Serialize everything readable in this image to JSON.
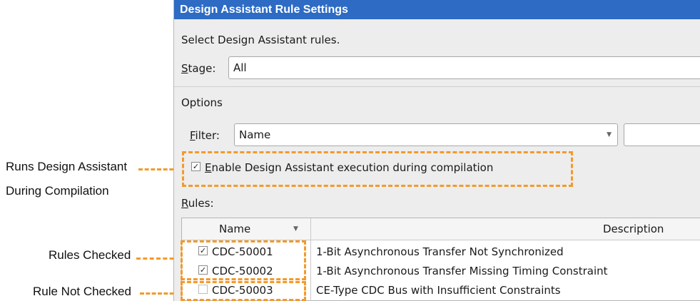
{
  "dialog": {
    "title": "Design Assistant Rule Settings",
    "instruction": "Select Design Assistant rules.",
    "stage": {
      "label_key": "S",
      "label_rest": "tage:",
      "value": "All"
    },
    "options_label": "Options",
    "filter": {
      "label_key": "F",
      "label_rest": "ilter:",
      "value": "Name",
      "text": ""
    },
    "enable_checkbox": {
      "checked_glyph": "✓",
      "label_key": "E",
      "label_rest": "nable Design Assistant execution during compilation",
      "checked": true
    },
    "rules_label": {
      "key": "R",
      "rest": "ules:"
    },
    "table": {
      "columns": {
        "name": "Name",
        "description": "Description"
      },
      "rows": [
        {
          "glyph": "✓",
          "checked": true,
          "name": "CDC-50001",
          "description": "1-Bit Asynchronous Transfer Not Synchronized"
        },
        {
          "glyph": "✓",
          "checked": true,
          "name": "CDC-50002",
          "description": "1-Bit Asynchronous Transfer Missing Timing Constraint"
        },
        {
          "glyph": "",
          "checked": false,
          "name": "CDC-50003",
          "description": "CE-Type CDC Bus with Insufficient Constraints"
        }
      ]
    }
  },
  "annotations": {
    "runs_line1": "Runs Design Assistant",
    "runs_line2": "During Compilation",
    "rules_checked": "Rules Checked",
    "rule_not_checked": "Rule Not Checked"
  },
  "colors": {
    "title_bar": "#2d6bc4",
    "highlight": "#f39a2b",
    "panel": "#ededed"
  }
}
